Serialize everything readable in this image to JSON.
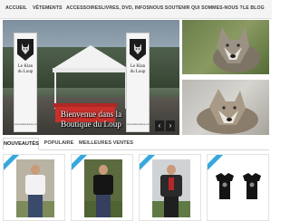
{
  "nav": {
    "items": [
      {
        "label": "ACCUEIL",
        "id": "accueil"
      },
      {
        "label": "VÊTEMENTS",
        "id": "vetements"
      },
      {
        "label": "ACCESSOIRES",
        "id": "accessoires"
      },
      {
        "label": "LIVRES, DVD, INFOS",
        "id": "livres"
      },
      {
        "label": "NOUS SOUTENIR",
        "id": "soutenir"
      },
      {
        "label": "QUI SOMMES-NOUS ?",
        "id": "qui"
      },
      {
        "label": "LE BLOG",
        "id": "blog"
      }
    ]
  },
  "hero": {
    "welcome_line1": "Bienvenue dans la",
    "welcome_line2": "Boutique du Loup",
    "banner_name_line1": "Le Klan",
    "banner_name_line2": "du Loup",
    "banner_url": "www.leklanduloup.com",
    "prev_label": "‹",
    "next_label": "›",
    "prev_icon": "chevron-left-icon",
    "next_icon": "chevron-right-icon"
  },
  "tabs": [
    {
      "label": "NOUVEAUTÉS",
      "active": true
    },
    {
      "label": "POPULAIRE",
      "active": false
    },
    {
      "label": "MEILLEURES VENTES",
      "active": false
    }
  ],
  "colors": {
    "ribbon": "#36a8dd",
    "banner_table": "#c9302c",
    "nav_bg": "#f4f4f4"
  }
}
